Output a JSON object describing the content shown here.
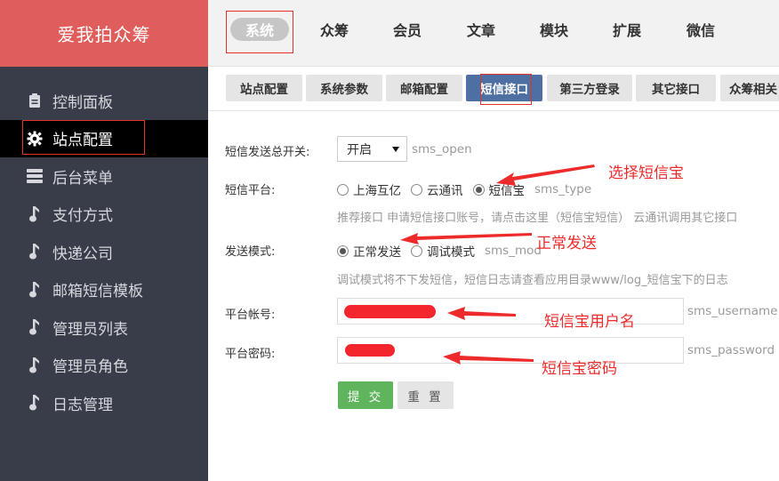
{
  "brand": "爱我拍众筹",
  "sidebar": {
    "items": [
      {
        "label": "控制面板",
        "icon": "clipboard-icon"
      },
      {
        "label": "站点配置",
        "icon": "gear-icon",
        "active": true
      },
      {
        "label": "后台菜单",
        "icon": "list-icon"
      },
      {
        "label": "支付方式",
        "icon": "music-note-icon"
      },
      {
        "label": "快递公司",
        "icon": "music-note-icon"
      },
      {
        "label": "邮箱短信模板",
        "icon": "music-note-icon"
      },
      {
        "label": "管理员列表",
        "icon": "music-note-icon"
      },
      {
        "label": "管理员角色",
        "icon": "music-note-icon"
      },
      {
        "label": "日志管理",
        "icon": "music-note-icon"
      }
    ]
  },
  "topnav": {
    "items": [
      {
        "label": "系统",
        "active": true
      },
      {
        "label": "众筹"
      },
      {
        "label": "会员"
      },
      {
        "label": "文章"
      },
      {
        "label": "模块"
      },
      {
        "label": "扩展"
      },
      {
        "label": "微信"
      }
    ]
  },
  "subtabs": {
    "items": [
      {
        "label": "站点配置"
      },
      {
        "label": "系统参数"
      },
      {
        "label": "邮箱配置"
      },
      {
        "label": "短信接口",
        "active": true
      },
      {
        "label": "第三方登录"
      },
      {
        "label": "其它接口"
      },
      {
        "label": "众筹相关"
      }
    ]
  },
  "form": {
    "sms_open": {
      "label": "短信发送总开关:",
      "value": "开启",
      "key": "sms_open"
    },
    "sms_type": {
      "label": "短信平台:",
      "options": [
        "上海互亿",
        "云通讯",
        "短信宝"
      ],
      "selected": "短信宝",
      "key": "sms_type",
      "hint": "推荐接口 申请短信接口账号，请点击这里（短信宝短信） 云通讯调用其它接口"
    },
    "sms_mod": {
      "label": "发送模式:",
      "options": [
        "正常发送",
        "调试模式"
      ],
      "selected": "正常发送",
      "key": "sms_mod",
      "hint": "调试模式将不下发短信，短信日志请查看应用目录www/log_短信宝下的日志"
    },
    "sms_username": {
      "label": "平台帐号:",
      "key": "sms_username"
    },
    "sms_password": {
      "label": "平台密码:",
      "key": "sms_password"
    },
    "submit_label": "提 交",
    "reset_label": "重 置"
  },
  "annotations": {
    "choose": "选择短信宝",
    "normal": "正常发送",
    "username": "短信宝用户名",
    "password": "短信宝密码"
  },
  "colors": {
    "brand_bg": "#df5d5a",
    "sidebar_bg": "#393d49",
    "active_tab": "#4d6fa1",
    "submit_bg": "#5fb45c",
    "annotation": "#ee2b2b"
  }
}
